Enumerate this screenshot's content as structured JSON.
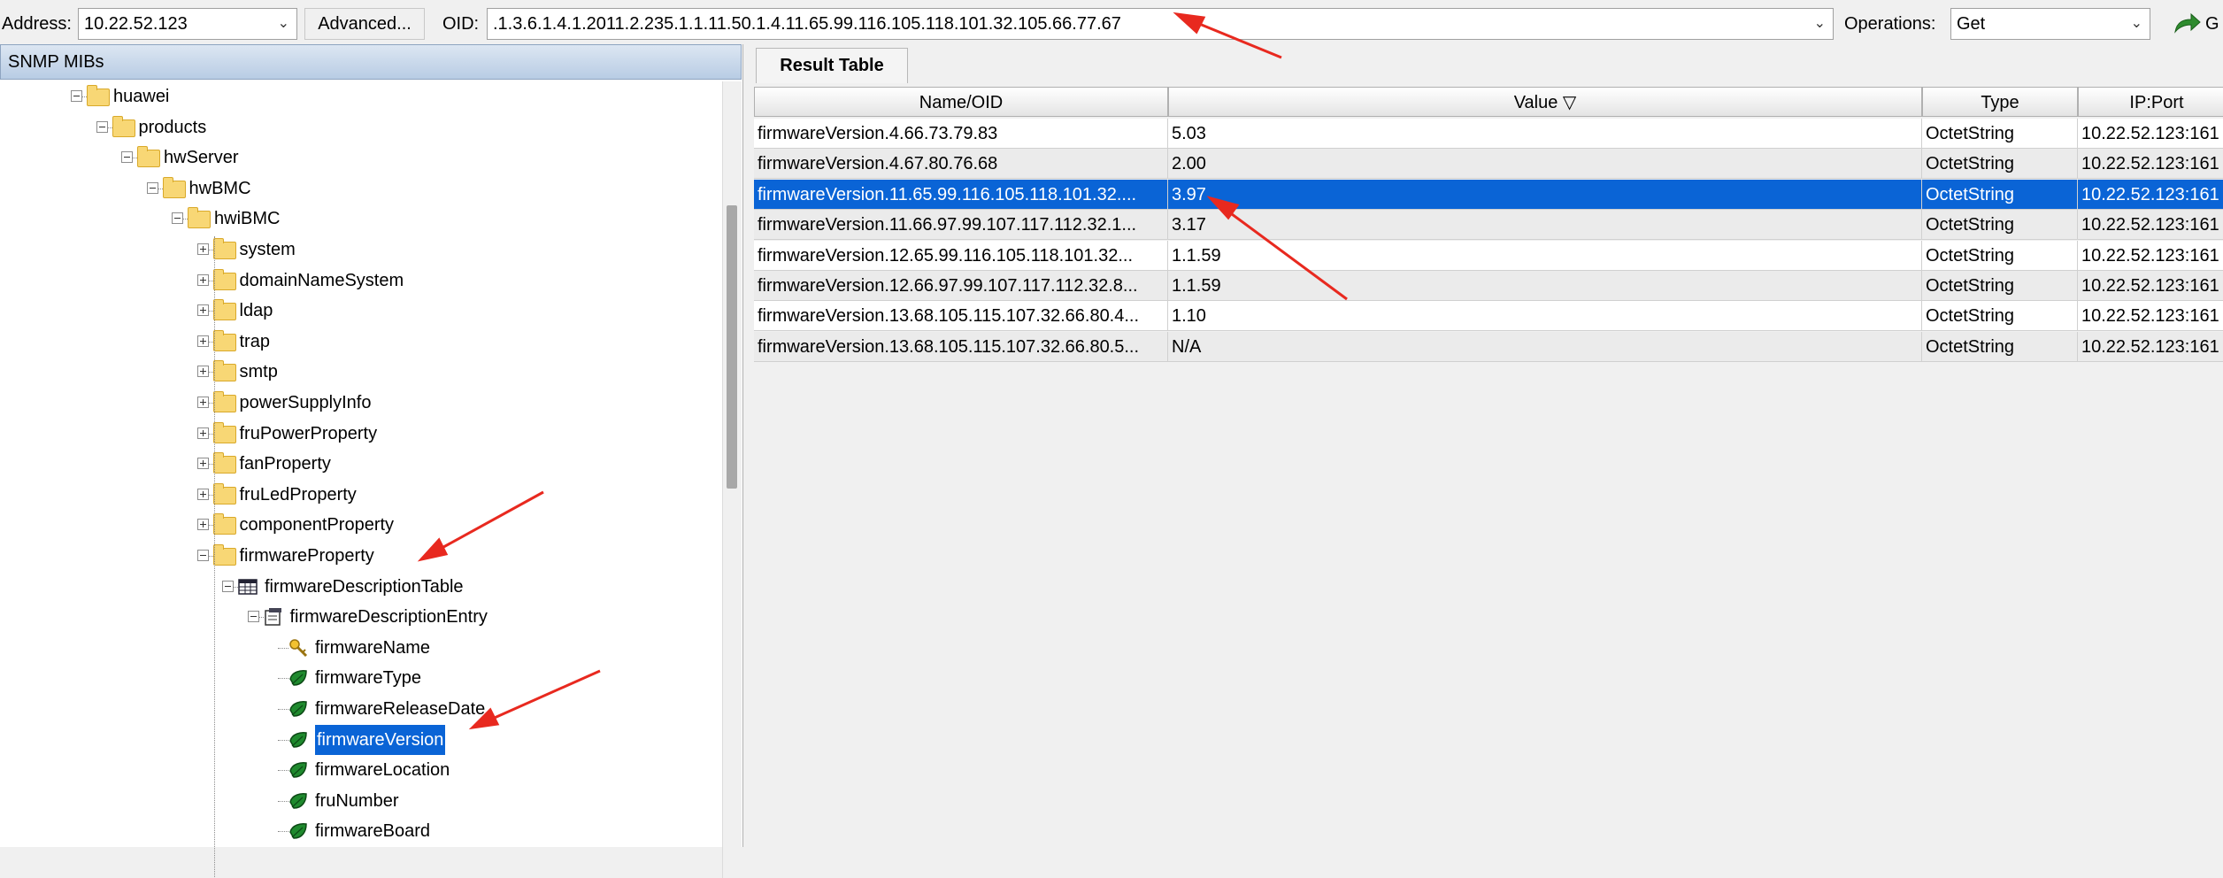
{
  "toolbar": {
    "address_label": "Address:",
    "address_value": "10.22.52.123",
    "advanced_label": "Advanced...",
    "oid_label": "OID:",
    "oid_value": ".1.3.6.1.4.1.2011.2.235.1.1.11.50.1.4.11.65.99.116.105.118.101.32.105.66.77.67",
    "operations_label": "Operations:",
    "operations_value": "Get",
    "go_label": "G"
  },
  "left": {
    "header": "SNMP MIBs",
    "tree": [
      {
        "label": "huawei",
        "icon": "folder"
      },
      {
        "label": "products",
        "icon": "folder"
      },
      {
        "label": "hwServer",
        "icon": "folder"
      },
      {
        "label": "hwBMC",
        "icon": "folder"
      },
      {
        "label": "hwiBMC",
        "icon": "folder"
      },
      {
        "label": "system",
        "icon": "folder"
      },
      {
        "label": "domainNameSystem",
        "icon": "folder"
      },
      {
        "label": "ldap",
        "icon": "folder"
      },
      {
        "label": "trap",
        "icon": "folder"
      },
      {
        "label": "smtp",
        "icon": "folder"
      },
      {
        "label": "powerSupplyInfo",
        "icon": "folder"
      },
      {
        "label": "fruPowerProperty",
        "icon": "folder"
      },
      {
        "label": "fanProperty",
        "icon": "folder"
      },
      {
        "label": "fruLedProperty",
        "icon": "folder"
      },
      {
        "label": "componentProperty",
        "icon": "folder"
      },
      {
        "label": "firmwareProperty",
        "icon": "folder"
      },
      {
        "label": "firmwareDescriptionTable",
        "icon": "table-icon"
      },
      {
        "label": "firmwareDescriptionEntry",
        "icon": "entry-icon"
      },
      {
        "label": "firmwareName",
        "icon": "key-icon"
      },
      {
        "label": "firmwareType",
        "icon": "leaf-icon"
      },
      {
        "label": "firmwareReleaseDate",
        "icon": "leaf-icon"
      },
      {
        "label": "firmwareVersion",
        "icon": "leaf-icon"
      },
      {
        "label": "firmwareLocation",
        "icon": "leaf-icon"
      },
      {
        "label": "fruNumber",
        "icon": "leaf-icon"
      },
      {
        "label": "firmwareBoard",
        "icon": "leaf-icon"
      }
    ]
  },
  "right": {
    "tab_label": "Result Table",
    "columns": [
      "Name/OID",
      "Value",
      "Type",
      "IP:Port"
    ],
    "rows": [
      [
        "firmwareVersion.4.66.73.79.83",
        "5.03",
        "OctetString",
        "10.22.52.123:161"
      ],
      [
        "firmwareVersion.4.67.80.76.68",
        "2.00",
        "OctetString",
        "10.22.52.123:161"
      ],
      [
        "firmwareVersion.11.65.99.116.105.118.101.32....",
        "3.97",
        "OctetString",
        "10.22.52.123:161"
      ],
      [
        "firmwareVersion.11.66.97.99.107.117.112.32.1...",
        "3.17",
        "OctetString",
        "10.22.52.123:161"
      ],
      [
        "firmwareVersion.12.65.99.116.105.118.101.32...",
        "1.1.59",
        "OctetString",
        "10.22.52.123:161"
      ],
      [
        "firmwareVersion.12.66.97.99.107.117.112.32.8...",
        "1.1.59",
        "OctetString",
        "10.22.52.123:161"
      ],
      [
        "firmwareVersion.13.68.105.115.107.32.66.80.4...",
        "1.10",
        "OctetString",
        "10.22.52.123:161"
      ],
      [
        "firmwareVersion.13.68.105.115.107.32.66.80.5...",
        "N/A",
        "OctetString",
        "10.22.52.123:161"
      ]
    ],
    "selected_row": 2
  },
  "colors": {
    "selection": "#0a64d6",
    "annotation_arrow": "#e8291f"
  }
}
